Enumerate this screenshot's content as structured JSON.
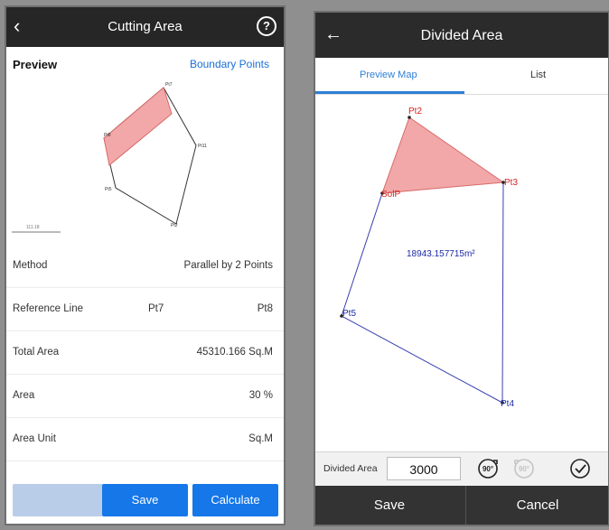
{
  "left": {
    "header": {
      "back_icon": "chevron-left-icon",
      "title": "Cutting Area",
      "help_icon": "help-icon"
    },
    "preview_title": "Preview",
    "boundary_points_link": "Boundary Points",
    "map": {
      "points": [
        "Pt7",
        "Pt8",
        "Pt11",
        "Pt5",
        "Pt2"
      ],
      "scale_text": "111.18"
    },
    "rows": {
      "method": {
        "label": "Method",
        "value": "Parallel by 2 Points"
      },
      "reference_line": {
        "label": "Reference Line",
        "from": "Pt7",
        "to": "Pt8"
      },
      "total_area": {
        "label": "Total Area",
        "value": "45310.166 Sq.M"
      },
      "area": {
        "label": "Area",
        "value": "30 %"
      },
      "area_unit": {
        "label": "Area Unit",
        "value": "Sq.M"
      }
    },
    "buttons": {
      "save": "Save",
      "calculate": "Calculate"
    },
    "colors": {
      "accent": "#1677e8",
      "highlight_fill": "#f2a8a8"
    }
  },
  "right": {
    "header": {
      "back_icon": "arrow-left-icon",
      "title": "Divided Area"
    },
    "tabs": {
      "preview_map": "Preview Map",
      "list": "List"
    },
    "map": {
      "points": {
        "pt2": "Pt2",
        "pt3": "Pt3",
        "solp": "SolP",
        "pt5": "Pt5",
        "pt4": "Pt4"
      },
      "area_text": "18943.157715m²"
    },
    "footer": {
      "label": "Divided Area",
      "value": "3000",
      "rotate_cw_label": "90°",
      "rotate_ccw_label": "90°",
      "confirm_icon": "check-circle-icon"
    },
    "buttons": {
      "save": "Save",
      "cancel": "Cancel"
    },
    "colors": {
      "accent": "#2f7fd6",
      "point_label": "#d32222",
      "area_label": "#1c2aa6"
    }
  }
}
